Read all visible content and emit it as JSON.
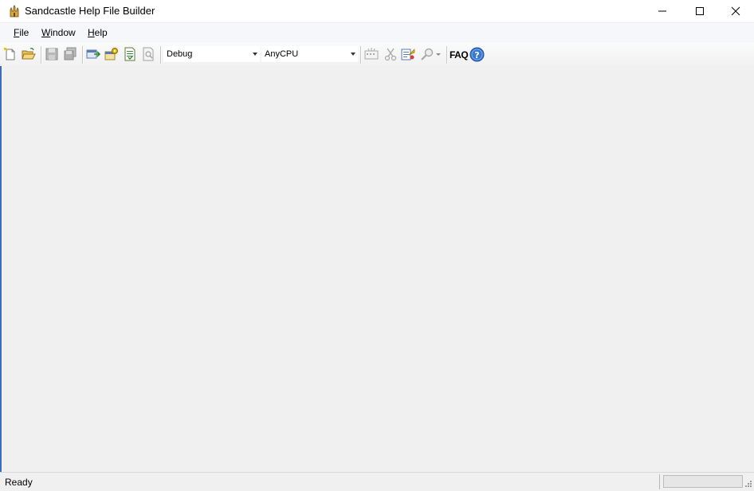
{
  "window": {
    "title": "Sandcastle Help File Builder"
  },
  "menu": {
    "items": [
      {
        "mnemonic": "F",
        "rest": "ile"
      },
      {
        "mnemonic": "W",
        "rest": "indow"
      },
      {
        "mnemonic": "H",
        "rest": "elp"
      }
    ]
  },
  "toolbar": {
    "configuration": "Debug",
    "platform": "AnyCPU",
    "faq_label": "FAQ",
    "icons": [
      "new-project-icon",
      "open-project-icon",
      "save-icon",
      "save-all-icon",
      "build-icon",
      "build-settings-icon",
      "view-help-icon",
      "view-log-icon",
      "entity-references-icon",
      "cut-icon",
      "project-properties-icon",
      "search-icon",
      "help-icon"
    ]
  },
  "status": {
    "text": "Ready",
    "progress": 0
  }
}
